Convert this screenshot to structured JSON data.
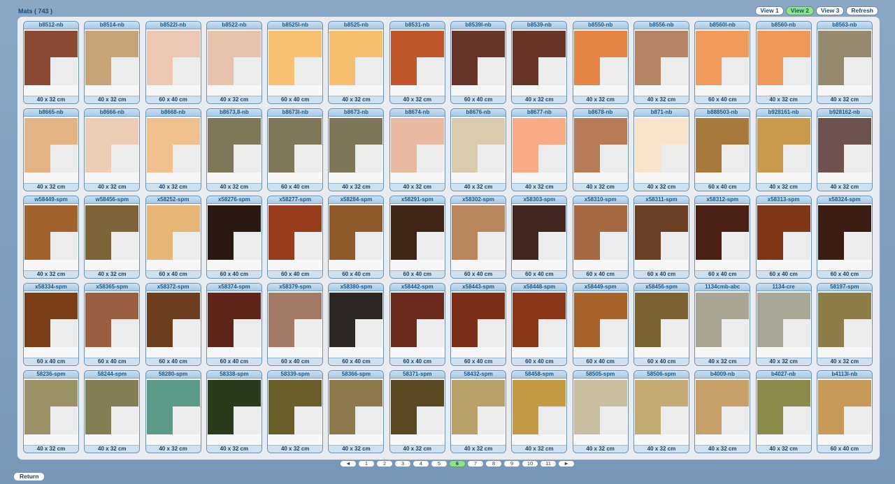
{
  "header": {
    "title": "Mats  ( 743 )"
  },
  "views": [
    "View 1",
    "View 2",
    "View 3",
    "Refresh"
  ],
  "active_view": "View 2",
  "tiles": [
    {
      "name": "b8512-nb",
      "size": "40 x 32 cm",
      "color": "#8a4a34"
    },
    {
      "name": "b8514-nb",
      "size": "40 x 32 cm",
      "color": "#c8a47a"
    },
    {
      "name": "b8522l-nb",
      "size": "60 x 40 cm",
      "color": "#ecc8b4"
    },
    {
      "name": "b8522-nb",
      "size": "40 x 32 cm",
      "color": "#e7c2ad"
    },
    {
      "name": "b8525l-nb",
      "size": "60 x 40 cm",
      "color": "#f7c072"
    },
    {
      "name": "b8525-nb",
      "size": "40 x 32 cm",
      "color": "#f6bf70"
    },
    {
      "name": "b8531-nb",
      "size": "40 x 32 cm",
      "color": "#c0562c"
    },
    {
      "name": "b8539l-nb",
      "size": "60 x 40 cm",
      "color": "#66342a"
    },
    {
      "name": "b8539-nb",
      "size": "40 x 32 cm",
      "color": "#693428"
    },
    {
      "name": "b8550-nb",
      "size": "40 x 32 cm",
      "color": "#e58646"
    },
    {
      "name": "b8556-nb",
      "size": "40 x 32 cm",
      "color": "#b58465"
    },
    {
      "name": "b8560l-nb",
      "size": "60 x 40 cm",
      "color": "#f09a5c"
    },
    {
      "name": "b8560-nb",
      "size": "40 x 32 cm",
      "color": "#ee985b"
    },
    {
      "name": "b8563-nb",
      "size": "40 x 32 cm",
      "color": "#958a70"
    },
    {
      "name": "b8665-nb",
      "size": "40 x 32 cm",
      "color": "#e4b487"
    },
    {
      "name": "b8666-nb",
      "size": "40 x 32 cm",
      "color": "#eccdb6"
    },
    {
      "name": "b8668-nb",
      "size": "40 x 32 cm",
      "color": "#f0c18e"
    },
    {
      "name": "b8673,8-nb",
      "size": "40 x 32 cm",
      "color": "#7f7858"
    },
    {
      "name": "b8673l-nb",
      "size": "60 x 40 cm",
      "color": "#7e775a"
    },
    {
      "name": "b8673-nb",
      "size": "40 x 32 cm",
      "color": "#7d7659"
    },
    {
      "name": "b8674-nb",
      "size": "40 x 32 cm",
      "color": "#e7b9a0"
    },
    {
      "name": "b8676-nb",
      "size": "40 x 32 cm",
      "color": "#d8cbae"
    },
    {
      "name": "b8677-nb",
      "size": "40 x 32 cm",
      "color": "#f7ac86"
    },
    {
      "name": "b8678-nb",
      "size": "40 x 32 cm",
      "color": "#b77c57"
    },
    {
      "name": "b871-nb",
      "size": "40 x 32 cm",
      "color": "#f6e4cc"
    },
    {
      "name": "b888503-nb",
      "size": "60 x 40 cm",
      "color": "#a57a3c"
    },
    {
      "name": "b928161-nb",
      "size": "40 x 32 cm",
      "color": "#c8994e"
    },
    {
      "name": "b928162-nb",
      "size": "40 x 32 cm",
      "color": "#6e5250"
    },
    {
      "name": "w58449-spm",
      "size": "40 x 32 cm",
      "color": "#a2622e"
    },
    {
      "name": "w58456-spm",
      "size": "40 x 32 cm",
      "color": "#7c6438"
    },
    {
      "name": "x58252-spm",
      "size": "60 x 40 cm",
      "color": "#e6b676"
    },
    {
      "name": "x58276-spm",
      "size": "60 x 40 cm",
      "color": "#2a1812"
    },
    {
      "name": "x58277-spm",
      "size": "60 x 40 cm",
      "color": "#973c1c"
    },
    {
      "name": "x58284-spm",
      "size": "60 x 40 cm",
      "color": "#8f5a2a"
    },
    {
      "name": "x58291-spm",
      "size": "60 x 40 cm",
      "color": "#3f2418"
    },
    {
      "name": "x58302-spm",
      "size": "60 x 40 cm",
      "color": "#b8865c"
    },
    {
      "name": "x58303-spm",
      "size": "60 x 40 cm",
      "color": "#402620"
    },
    {
      "name": "x58310-spm",
      "size": "60 x 40 cm",
      "color": "#a66a42"
    },
    {
      "name": "x58311-spm",
      "size": "60 x 40 cm",
      "color": "#6a3f26"
    },
    {
      "name": "x58312-spm",
      "size": "60 x 40 cm",
      "color": "#4a1f16"
    },
    {
      "name": "x58313-spm",
      "size": "60 x 40 cm",
      "color": "#7e3616"
    },
    {
      "name": "x58324-spm",
      "size": "60 x 40 cm",
      "color": "#3a1d12"
    },
    {
      "name": "x58334-spm",
      "size": "60 x 40 cm",
      "color": "#7a3e16"
    },
    {
      "name": "x58365-spm",
      "size": "60 x 40 cm",
      "color": "#9a5e42"
    },
    {
      "name": "x58372-spm",
      "size": "60 x 40 cm",
      "color": "#6a3e1e"
    },
    {
      "name": "x58374-spm",
      "size": "60 x 40 cm",
      "color": "#5e261a"
    },
    {
      "name": "x58379-spm",
      "size": "60 x 40 cm",
      "color": "#a07a66"
    },
    {
      "name": "x58380-spm",
      "size": "60 x 40 cm",
      "color": "#2c2624"
    },
    {
      "name": "x58442-spm",
      "size": "60 x 40 cm",
      "color": "#6a2a1e"
    },
    {
      "name": "x58443-spm",
      "size": "60 x 40 cm",
      "color": "#7a2e18"
    },
    {
      "name": "x58448-spm",
      "size": "60 x 40 cm",
      "color": "#8a3618"
    },
    {
      "name": "x58449-spm",
      "size": "60 x 40 cm",
      "color": "#a8622c"
    },
    {
      "name": "x58456-spm",
      "size": "60 x 40 cm",
      "color": "#7a6234"
    },
    {
      "name": "1134cmb-abc",
      "size": "40 x 32 cm",
      "color": "#a9a594"
    },
    {
      "name": "1134-cre",
      "size": "40 x 32 cm",
      "color": "#a9a898"
    },
    {
      "name": "58197-spm",
      "size": "40 x 32 cm",
      "color": "#8c7c48"
    },
    {
      "name": "58236-spm",
      "size": "40 x 32 cm",
      "color": "#9a9266"
    },
    {
      "name": "58244-spm",
      "size": "40 x 32 cm",
      "color": "#847e54"
    },
    {
      "name": "58280-spm",
      "size": "40 x 32 cm",
      "color": "#5e9a8a"
    },
    {
      "name": "58338-spm",
      "size": "40 x 32 cm",
      "color": "#2a3a1c"
    },
    {
      "name": "58339-spm",
      "size": "40 x 32 cm",
      "color": "#6a5e2a"
    },
    {
      "name": "58366-spm",
      "size": "40 x 32 cm",
      "color": "#8c7a4c"
    },
    {
      "name": "58371-spm",
      "size": "40 x 32 cm",
      "color": "#5a4a24"
    },
    {
      "name": "58432-spm",
      "size": "40 x 32 cm",
      "color": "#b8a06a"
    },
    {
      "name": "58458-spm",
      "size": "40 x 32 cm",
      "color": "#c49a44"
    },
    {
      "name": "58505-spm",
      "size": "40 x 32 cm",
      "color": "#c8bea0"
    },
    {
      "name": "58506-spm",
      "size": "40 x 32 cm",
      "color": "#c2aa72"
    },
    {
      "name": "b4009-nb",
      "size": "40 x 32 cm",
      "color": "#c8a06a"
    },
    {
      "name": "b4027-nb",
      "size": "40 x 32 cm",
      "color": "#8a8a4a"
    },
    {
      "name": "b4113l-nb",
      "size": "60 x 40 cm",
      "color": "#c89a5a"
    }
  ],
  "pagination": {
    "prev": "◄",
    "pages": [
      "1",
      "2",
      "3",
      "4",
      "5",
      "6",
      "7",
      "8",
      "9",
      "10",
      "11"
    ],
    "current": "6",
    "next": "►"
  },
  "footer": {
    "return_label": "Return"
  }
}
